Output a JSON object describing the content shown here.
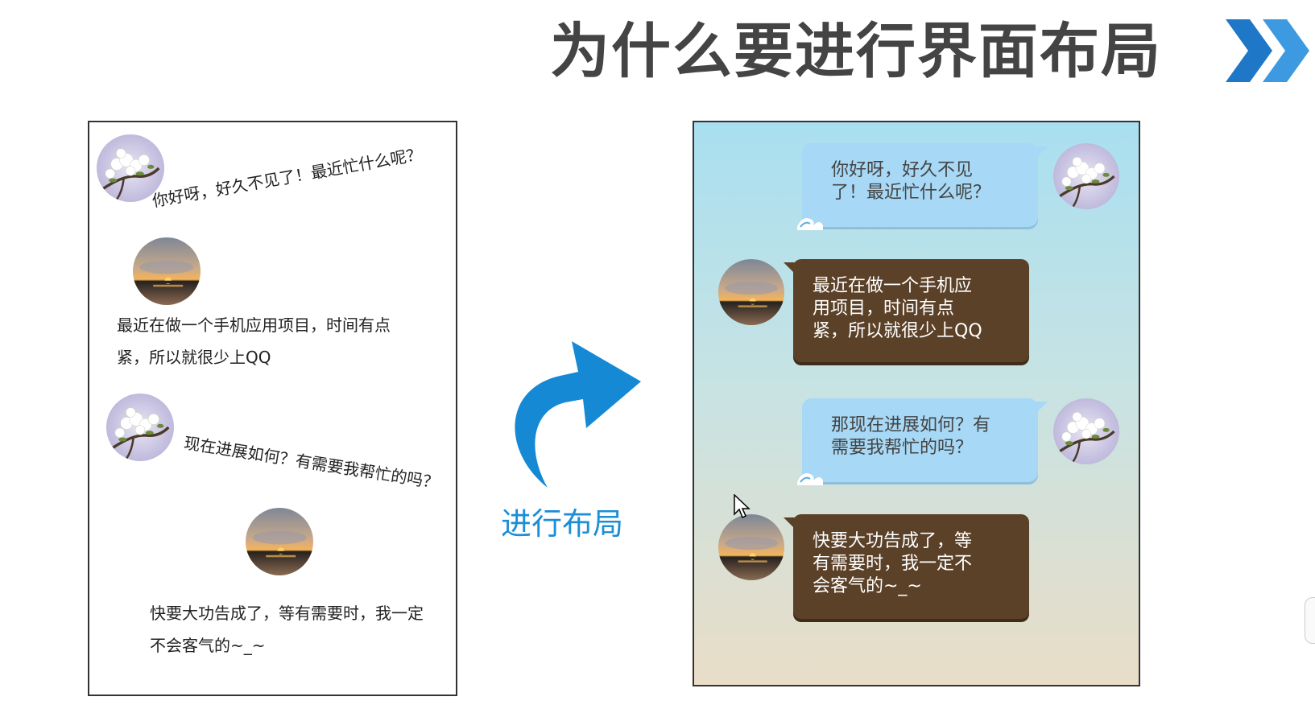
{
  "slide": {
    "title": "为什么要进行界面布局"
  },
  "left_panel": {
    "messages": [
      "你好呀，好久不见了！最近忙什么呢？",
      "最近在做一个手机应用项目，时间有点",
      "紧，所以就很少上QQ",
      "现在进展如何？有需要我帮忙的吗？",
      "快要大功告成了，等有需要时，我一定",
      "不会客气的~_~"
    ]
  },
  "transition": {
    "label": "进行布局"
  },
  "right_panel": {
    "bubbles": [
      {
        "lines": [
          "你好呀，好久不见",
          "了！最近忙什么呢？"
        ]
      },
      {
        "lines": [
          "最近在做一个手机应",
          "用项目，时间有点",
          "紧，所以就很少上QQ"
        ]
      },
      {
        "lines": [
          "那现在进展如何？有",
          "需要我帮忙的吗？"
        ]
      },
      {
        "lines": [
          "快要大功告成了，等",
          "有需要时，我一定不",
          "会客气的~_~"
        ]
      }
    ]
  },
  "colors": {
    "title": "#444444",
    "accent_blue": "#1a8ed6",
    "bubble_blue": "#a7d8f5",
    "bubble_brown": "#5b4128"
  },
  "icons": [
    "chevron-right-icon",
    "curved-arrow-icon",
    "mouse-cursor-icon",
    "flower-avatar",
    "sunset-avatar"
  ]
}
